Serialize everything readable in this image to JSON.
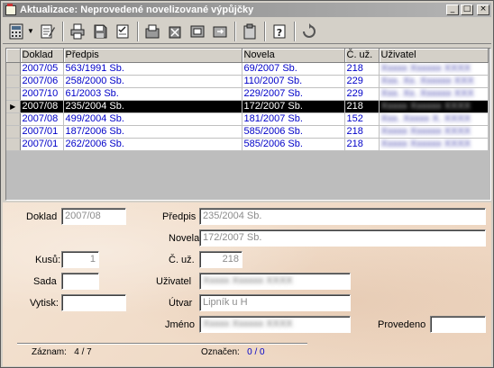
{
  "window": {
    "title": "Aktualizace: Neprovedené novelizované výpůjčky",
    "buttons": {
      "minimize": "_",
      "maximize": "□",
      "close": "×"
    }
  },
  "toolbar": {
    "icons": [
      "calculator-icon",
      "edit-document-icon",
      "print-icon",
      "save-icon",
      "checklist-icon",
      "cut-icon",
      "delete-icon",
      "copy-icon",
      "paste-icon",
      "clipboard-icon",
      "help-icon",
      "refresh-icon"
    ]
  },
  "grid": {
    "columns": [
      "Doklad",
      "Předpis",
      "Novela",
      "Č. už.",
      "Uživatel"
    ],
    "rows": [
      {
        "doklad": "2007/05",
        "predpis": "563/1991 Sb.",
        "novela": "69/2007 Sb.",
        "cuz": "218",
        "uzivatel": "Xxxxx Xxxxxx XXXX"
      },
      {
        "doklad": "2007/06",
        "predpis": "258/2000 Sb.",
        "novela": "110/2007 Sb.",
        "cuz": "229",
        "uzivatel": "Xxx. Xx. Xxxxxx XXX"
      },
      {
        "doklad": "2007/10",
        "predpis": "61/2003 Sb.",
        "novela": "229/2007 Sb.",
        "cuz": "229",
        "uzivatel": "Xxx. Xx. Xxxxxx XXX"
      },
      {
        "doklad": "2007/08",
        "predpis": "235/2004 Sb.",
        "novela": "172/2007 Sb.",
        "cuz": "218",
        "uzivatel": "Xxxxx Xxxxxx XXXX",
        "selected": true
      },
      {
        "doklad": "2007/08",
        "predpis": "499/2004 Sb.",
        "novela": "181/2007 Sb.",
        "cuz": "152",
        "uzivatel": "Xxx. Xxxxx X. XXXX"
      },
      {
        "doklad": "2007/01",
        "predpis": "187/2006 Sb.",
        "novela": "585/2006 Sb.",
        "cuz": "218",
        "uzivatel": "Xxxxx Xxxxxx XXXX"
      },
      {
        "doklad": "2007/01",
        "predpis": "262/2006 Sb.",
        "novela": "585/2006 Sb.",
        "cuz": "218",
        "uzivatel": "Xxxxx Xxxxxx XXXX"
      }
    ],
    "row_indicator": "▶"
  },
  "form": {
    "doklad_label": "Doklad",
    "doklad_value": "2007/08",
    "predpis_label": "Předpis",
    "predpis_value": "235/2004 Sb.",
    "novela_label": "Novela",
    "novela_value": "172/2007 Sb.",
    "kusu_label": "Kusů:",
    "kusu_value": "1",
    "cuz_label": "Č. už.",
    "cuz_value": "218",
    "sada_label": "Sada",
    "sada_value": "",
    "uzivatel_label": "Uživatel",
    "uzivatel_value": "Xxxxx Xxxxxx XXXX",
    "vytisk_label": "Vytisk:",
    "vytisk_value": "",
    "utvar_label": "Útvar",
    "utvar_value": "Lipník u H",
    "jmeno_label": "Jméno",
    "jmeno_value": "Xxxxx Xxxxxx XXXX",
    "provedeno_label": "Provedeno",
    "provedeno_value": ""
  },
  "status": {
    "zaznam_label": "Záznam:",
    "zaznam_value": "4 / 7",
    "oznacen_label": "Označen:",
    "oznacen_value": "0 / 0"
  }
}
